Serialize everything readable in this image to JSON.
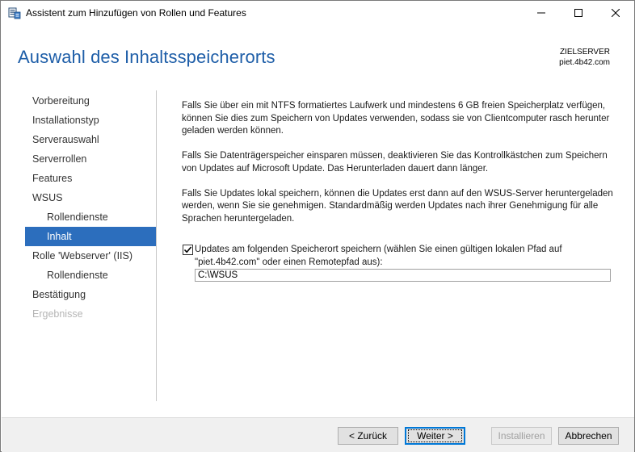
{
  "window": {
    "title": "Assistent zum Hinzufügen von Rollen und Features",
    "minimize_glyph": "—",
    "maximize_glyph": "☐",
    "close_glyph": "✕"
  },
  "header": {
    "page_title": "Auswahl des Inhaltsspeicherorts",
    "server_label": "ZIELSERVER",
    "server_name": "piet.4b42.com"
  },
  "nav": {
    "items": [
      {
        "label": "Vorbereitung",
        "state": "normal",
        "level": 0
      },
      {
        "label": "Installationstyp",
        "state": "normal",
        "level": 0
      },
      {
        "label": "Serverauswahl",
        "state": "normal",
        "level": 0
      },
      {
        "label": "Serverrollen",
        "state": "normal",
        "level": 0
      },
      {
        "label": "Features",
        "state": "normal",
        "level": 0
      },
      {
        "label": "WSUS",
        "state": "normal",
        "level": 0
      },
      {
        "label": "Rollendienste",
        "state": "normal",
        "level": 1
      },
      {
        "label": "Inhalt",
        "state": "active",
        "level": 1
      },
      {
        "label": "Rolle 'Webserver' (IIS)",
        "state": "normal",
        "level": 0
      },
      {
        "label": "Rollendienste",
        "state": "normal",
        "level": 1
      },
      {
        "label": "Bestätigung",
        "state": "normal",
        "level": 0
      },
      {
        "label": "Ergebnisse",
        "state": "disabled",
        "level": 0
      }
    ]
  },
  "content": {
    "paragraph_1": "Falls Sie über ein mit NTFS formatiertes Laufwerk und mindestens 6 GB freien Speicherplatz verfügen, können Sie dies zum Speichern von Updates verwenden, sodass sie von Clientcomputer rasch herunter geladen werden können.",
    "paragraph_2": "Falls Sie Datenträgerspeicher einsparen müssen, deaktivieren Sie das Kontrollkästchen zum Speichern von Updates auf Microsoft Update. Das Herunterladen dauert dann länger.",
    "paragraph_3": "Falls Sie Updates lokal speichern, können die Updates erst dann auf den WSUS-Server heruntergeladen werden, wenn Sie sie genehmigen. Standardmäßig werden Updates nach ihrer Genehmigung für alle Sprachen heruntergeladen.",
    "checkbox_label": "Updates am folgenden Speicherort speichern (wählen Sie einen gültigen lokalen Pfad auf \"piet.4b42.com\" oder einen Remotepfad aus):",
    "checkbox_checked": true,
    "path_value": "C:\\WSUS"
  },
  "footer": {
    "back_label": "< Zurück",
    "next_label": "Weiter >",
    "install_label": "Installieren",
    "cancel_label": "Abbrechen"
  },
  "colors": {
    "title_blue": "#1e5ea8",
    "nav_active": "#2c6ebd",
    "focus_border": "#0078d7"
  },
  "icons": {
    "app_icon": "server-manager-icon",
    "check_icon": "checkmark-icon"
  }
}
